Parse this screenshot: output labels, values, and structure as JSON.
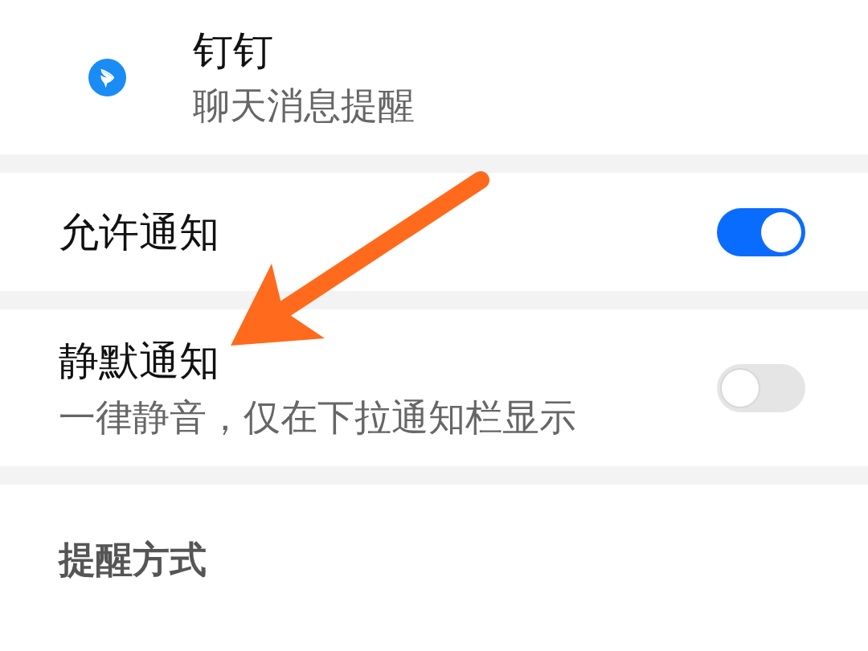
{
  "app": {
    "name": "钉钉",
    "subtitle": "聊天消息提醒"
  },
  "settings": [
    {
      "kind": "toggle",
      "label": "允许通知",
      "on": true
    },
    {
      "kind": "toggle",
      "label": "静默通知",
      "description": "一律静音，仅在下拉通知栏显示",
      "on": false
    }
  ],
  "section": {
    "label": "提醒方式"
  }
}
